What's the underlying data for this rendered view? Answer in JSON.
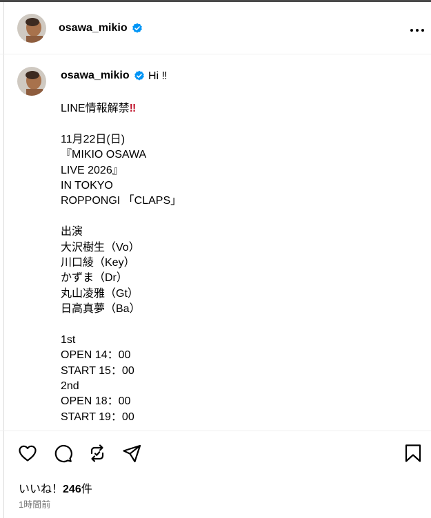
{
  "header": {
    "username": "osawa_mikio",
    "verified": true,
    "more_icon": "more-horizontal-icon"
  },
  "post": {
    "username": "osawa_mikio",
    "greeting": "Hi ‼︎",
    "caption_lines": [
      {
        "text": "LINE情報解禁",
        "emoji": "‼"
      },
      {
        "text": ""
      },
      {
        "text": "11月22日(日)"
      },
      {
        "text": "『MIKIO OSAWA"
      },
      {
        "text": "LIVE 2026』"
      },
      {
        "text": "IN TOKYO"
      },
      {
        "text": "ROPPONGI 「CLAPS」"
      },
      {
        "text": ""
      },
      {
        "text": "出演"
      },
      {
        "text": "大沢樹生（Vo）"
      },
      {
        "text": "川口綾（Key）"
      },
      {
        "text": "かずま（Dr）"
      },
      {
        "text": "丸山凌雅（Gt）"
      },
      {
        "text": "日高真夢（Ba）"
      },
      {
        "text": ""
      },
      {
        "text": "1st"
      },
      {
        "text": "OPEN 14：00"
      },
      {
        "text": "START 15：00"
      },
      {
        "text": "2nd"
      },
      {
        "text": "OPEN 18：00"
      },
      {
        "text": "START 19：00"
      }
    ]
  },
  "actions": {
    "icons": [
      "heart-icon",
      "comment-icon",
      "repost-icon",
      "share-icon",
      "bookmark-icon"
    ]
  },
  "likes": {
    "prefix": "いいね！",
    "count": "246",
    "suffix": "件"
  },
  "timestamp": "1時間前",
  "colors": {
    "verified_blue": "#0095f6",
    "secondary_text": "#737373",
    "divider": "#efefef"
  }
}
